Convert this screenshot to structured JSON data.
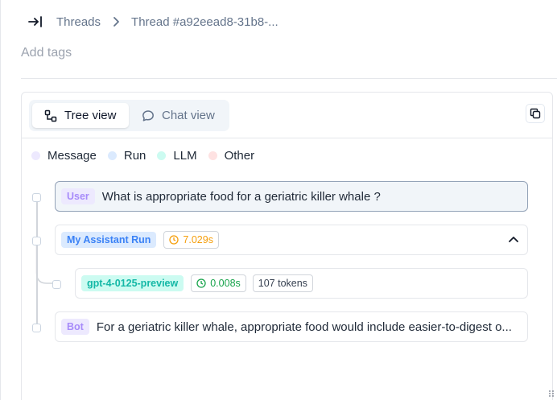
{
  "breadcrumb": {
    "threads_label": "Threads",
    "thread_label": "Thread #a92eead8-31b8-..."
  },
  "tags": {
    "placeholder": "Add tags"
  },
  "view_tabs": {
    "tree": "Tree view",
    "chat": "Chat view",
    "active": "Tree view"
  },
  "legend": [
    {
      "label": "Message",
      "color": "#ede9fe"
    },
    {
      "label": "Run",
      "color": "#dbeafe"
    },
    {
      "label": "LLM",
      "color": "#ccfbf1"
    },
    {
      "label": "Other",
      "color": "#fee2e2"
    }
  ],
  "steps": {
    "user": {
      "badge": "User",
      "text": "What is appropriate food for a geriatric killer whale ?"
    },
    "run": {
      "badge": "My Assistant Run",
      "duration": "7.029s"
    },
    "llm": {
      "badge": "gpt-4-0125-preview",
      "duration": "0.008s",
      "tokens": "107 tokens"
    },
    "bot": {
      "badge": "Bot",
      "text": "For a geriatric killer whale, appropriate food would include easier-to-digest o..."
    }
  },
  "icons": {
    "collapse": "collapse-sidebar-icon",
    "chevron": "chevron-right-icon",
    "tree": "tree-icon",
    "chat": "chat-bubble-icon",
    "copy": "copy-icon",
    "clock": "clock-icon",
    "chevron_up": "chevron-up-icon"
  }
}
